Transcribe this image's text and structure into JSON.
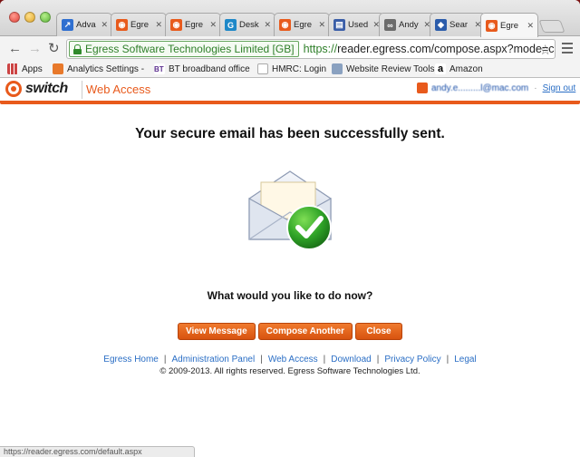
{
  "browser": {
    "tabs": [
      {
        "label": "Adva",
        "favicon": "google-analytics-icon",
        "color": "#2f6fd0"
      },
      {
        "label": "Egre",
        "favicon": "egress-icon",
        "color": "#e85a1c"
      },
      {
        "label": "Egre",
        "favicon": "egress-icon",
        "color": "#e85a1c"
      },
      {
        "label": "Desk",
        "favicon": "desk-icon",
        "color": "#1e88c8"
      },
      {
        "label": "Egre",
        "favicon": "egress-icon",
        "color": "#e85a1c"
      },
      {
        "label": "Used",
        "favicon": "document-icon",
        "color": "#3a5ea8"
      },
      {
        "label": "Andy",
        "favicon": "tripadvisor-icon",
        "color": "#6b6b6b"
      },
      {
        "label": "Sear",
        "favicon": "search-engine-icon",
        "color": "#2b5cab"
      },
      {
        "label": "Egre",
        "favicon": "egress-icon",
        "color": "#e85a1c"
      }
    ],
    "ev_badge": "Egress Software Technologies Limited [GB]",
    "url_scheme": "https://",
    "url_rest": "reader.egress.com/compose.aspx?mode=c...",
    "status_url": "https://reader.egress.com/default.aspx"
  },
  "bookmarks": [
    {
      "label": "Apps",
      "icon": "apps-grid-icon"
    },
    {
      "label": "Analytics Settings -",
      "icon": "analytics-icon"
    },
    {
      "label": "BT broadband office",
      "icon": "bt-icon"
    },
    {
      "label": "HMRC: Login",
      "icon": "page-icon"
    },
    {
      "label": "Website Review Tools",
      "icon": "folder-icon"
    },
    {
      "label": "Amazon",
      "icon": "amazon-icon"
    }
  ],
  "app": {
    "logo_text": "switch",
    "title": "Web Access",
    "user_email": "andy.e.........l@mac.com",
    "sign_out": "Sign out",
    "separator": "·"
  },
  "main": {
    "headline": "Your secure email has been successfully sent.",
    "question": "What would you like to do now?",
    "buttons": {
      "view": "View Message",
      "compose": "Compose Another",
      "close": "Close"
    }
  },
  "footer": {
    "links": [
      "Egress Home",
      "Administration Panel",
      "Web Access",
      "Download",
      "Privacy Policy",
      "Legal"
    ],
    "copyright": "© 2009-2013. All rights reserved. Egress Software Technologies Ltd."
  },
  "colors": {
    "brand": "#e85a1c",
    "link": "#2a6ec5",
    "ev_green": "#2f7f2a"
  }
}
